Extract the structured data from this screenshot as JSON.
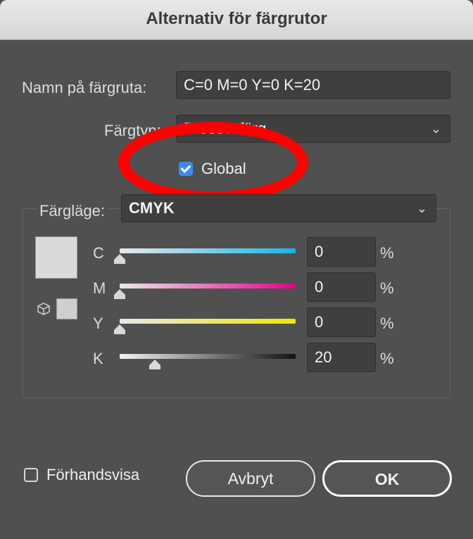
{
  "window": {
    "title": "Alternativ för färgrutor"
  },
  "swatch_name": {
    "label": "Namn på färgruta:",
    "value": "C=0 M=0 Y=0 K=20"
  },
  "color_type": {
    "label": "Färgtyp:",
    "value": "Processfärg"
  },
  "global": {
    "label": "Global",
    "checked": true
  },
  "color_mode": {
    "label": "Färgläge:",
    "value": "CMYK"
  },
  "channels": [
    {
      "letter": "C",
      "value": "0",
      "unit": "%",
      "level": 0.0
    },
    {
      "letter": "M",
      "value": "0",
      "unit": "%",
      "level": 0.0
    },
    {
      "letter": "Y",
      "value": "0",
      "unit": "%",
      "level": 0.0
    },
    {
      "letter": "K",
      "value": "20",
      "unit": "%",
      "level": 0.2
    }
  ],
  "preview": {
    "label": "Förhandsvisa",
    "checked": false
  },
  "buttons": {
    "cancel": "Avbryt",
    "ok": "OK"
  },
  "icons": {
    "chevron": "chevron-down-icon",
    "gamut": "cube-icon",
    "check": "checkmark-icon"
  },
  "colors": {
    "dialog_bg": "#505050",
    "checkbox_accent": "#3c8cf0",
    "annotation_red": "#ff0000",
    "cyan": "#1ab4e6",
    "magenta": "#e6008c",
    "yellow": "#f0e600",
    "black": "#111111"
  }
}
